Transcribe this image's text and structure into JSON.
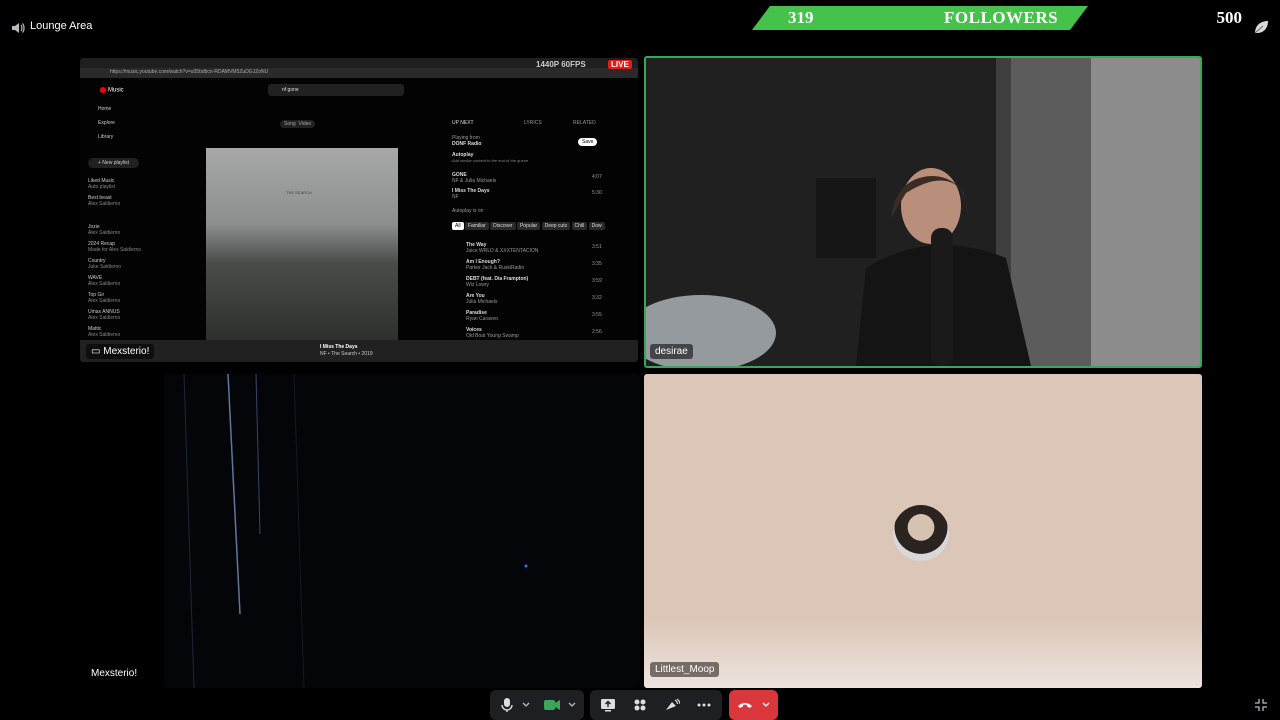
{
  "channel": {
    "name": "Lounge Area",
    "icon": "speaker-icon"
  },
  "follower_goal": {
    "current": "319",
    "label": "FOLLOWERS",
    "target": "500",
    "progress": 0.638
  },
  "tiles": {
    "screen_share": {
      "name": "Mexsterio!",
      "badge_res": "1440P 60FPS",
      "badge_live": "LIVE",
      "browser_url": "https://music.youtube.com/watch?v=u05bdbcn-RDAMVM5ZuDGJZoNU",
      "music": {
        "app": "Music",
        "search_value": "nf gone",
        "nav": [
          "Home",
          "Explore",
          "Library"
        ],
        "new_playlist": "+ New playlist",
        "playlists": [
          {
            "title": "Liked Music",
            "sub": "Auto playlist"
          },
          {
            "title": "Best beast",
            "sub": "Alex Saldierno"
          },
          {
            "title": "Jozie",
            "sub": "Alex Saldierno"
          },
          {
            "title": "2024 Recap",
            "sub": "Made for Alex Saldierno"
          },
          {
            "title": "Country",
            "sub": "Juke Saldierno"
          },
          {
            "title": "WAVE",
            "sub": "Alex Saldierno"
          },
          {
            "title": "Top Gir",
            "sub": "Alex Saldierno"
          },
          {
            "title": "Umax ANNUS",
            "sub": "Alex Saldierno"
          },
          {
            "title": "Mattic",
            "sub": "Alex Saldierno"
          }
        ],
        "song_tabs": [
          "Song",
          "Video"
        ],
        "album_text": "THE SEARCH",
        "queue_tabs": [
          "UP NEXT",
          "LYRICS",
          "RELATED"
        ],
        "playing_from": "Playing from",
        "radio": "DONF Radio",
        "save": "Save",
        "autoplay": "Autoplay",
        "autoplay_sub": "Add similar content to the end of the queue",
        "autoplay_on": "Autoplay is on",
        "chips": [
          "All",
          "Familiar",
          "Discover",
          "Popular",
          "Deep cuts",
          "Chill",
          "Dow"
        ],
        "queue": [
          {
            "title": "GONE",
            "artist": "NF & Julia Michaels",
            "time": "4:07"
          },
          {
            "title": "I Miss The Days",
            "artist": "NF",
            "time": "5:30"
          },
          {
            "title": "The Way",
            "artist": "Juice WRLD & XXXTENTACION",
            "time": "3:51"
          },
          {
            "title": "Am I Enough?",
            "artist": "Parker Jack & RuskiRadio",
            "time": "3:35"
          },
          {
            "title": "DEBT (feat. Dia Frampton)",
            "artist": "Wiz Lowry",
            "time": "3:59"
          },
          {
            "title": "Are You",
            "artist": "Julia Michaels",
            "time": "3:32"
          },
          {
            "title": "Paradise",
            "artist": "Ryan Caraveo",
            "time": "3:55"
          },
          {
            "title": "Voices",
            "artist": "Old Boat Young Swamp",
            "time": "2:56"
          }
        ],
        "now_playing": {
          "title": "I Miss The Days",
          "sub": "NF • The Search • 2019"
        }
      }
    },
    "camera": {
      "name": "desirae"
    },
    "dark": {
      "name": "Mexsterio!"
    },
    "avatar_tile": {
      "name": "Littlest_Moop"
    }
  },
  "controls": [
    {
      "name": "mic-icon",
      "label": "Microphone"
    },
    {
      "name": "camera-icon",
      "label": "Camera"
    },
    {
      "name": "screen-share-icon",
      "label": "Share Screen"
    },
    {
      "name": "activities-icon",
      "label": "Activities"
    },
    {
      "name": "soundboard-icon",
      "label": "Soundboard"
    },
    {
      "name": "more-icon",
      "label": "More"
    },
    {
      "name": "hangup-icon",
      "label": "Disconnect"
    }
  ],
  "colors": {
    "accent_green": "#3ba55c",
    "goal_green": "#45c24a",
    "danger": "#da373c",
    "live_red": "#e91916"
  }
}
